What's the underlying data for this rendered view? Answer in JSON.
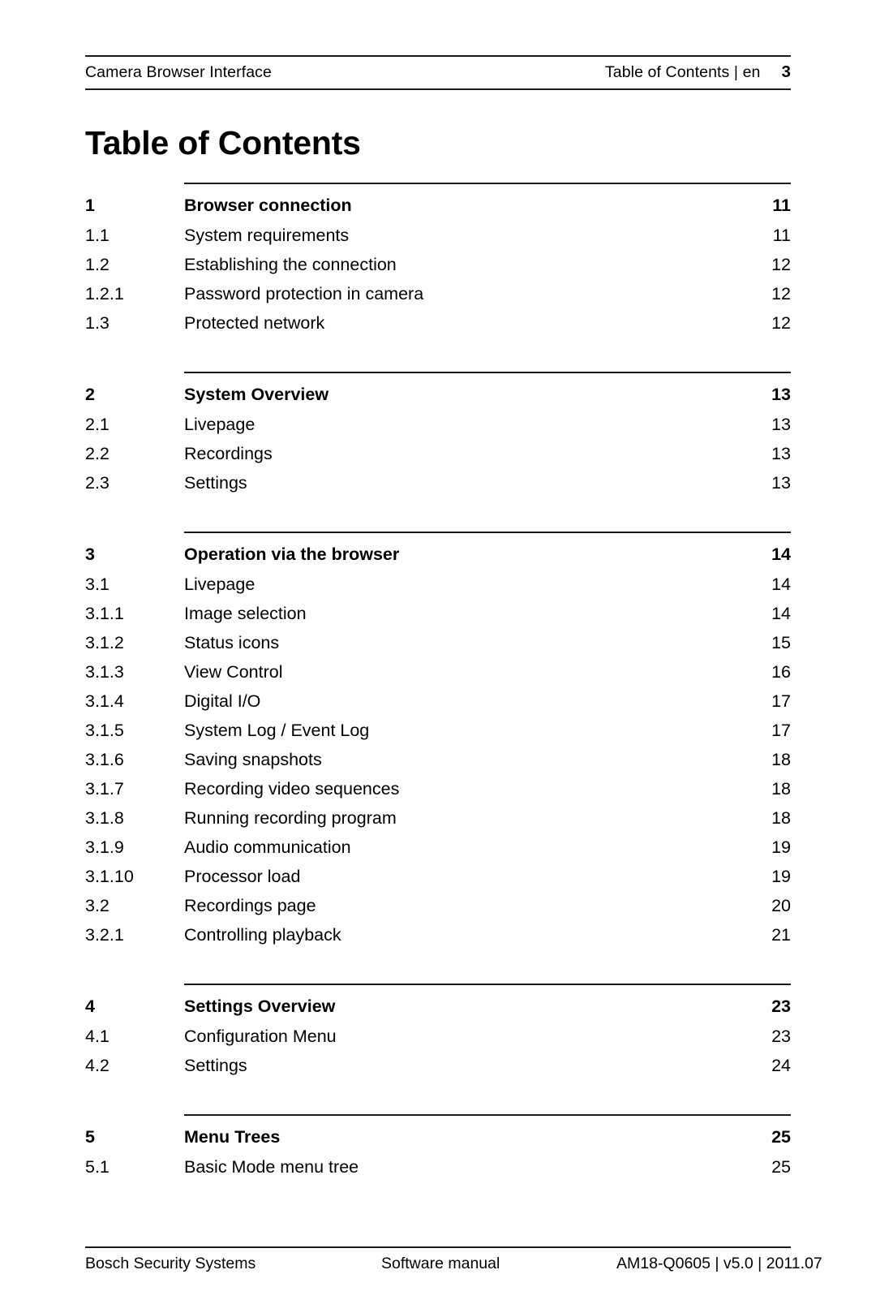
{
  "header": {
    "left_text": "Camera Browser Interface",
    "location": "Table of Contents | en",
    "page_number": "3"
  },
  "title": "Table of Contents",
  "toc": {
    "groups": [
      {
        "entries": [
          {
            "number": "1",
            "title": "Browser connection",
            "page": "11",
            "level": 1
          },
          {
            "number": "1.1",
            "title": "System requirements",
            "page": "11",
            "level": 2
          },
          {
            "number": "1.2",
            "title": "Establishing the connection",
            "page": "12",
            "level": 2
          },
          {
            "number": "1.2.1",
            "title": "Password protection in camera",
            "page": "12",
            "level": 3
          },
          {
            "number": "1.3",
            "title": "Protected network",
            "page": "12",
            "level": 2
          }
        ]
      },
      {
        "entries": [
          {
            "number": "2",
            "title": "System Overview",
            "page": "13",
            "level": 1
          },
          {
            "number": "2.1",
            "title": "Livepage",
            "page": "13",
            "level": 2
          },
          {
            "number": "2.2",
            "title": "Recordings",
            "page": "13",
            "level": 2
          },
          {
            "number": "2.3",
            "title": "Settings",
            "page": "13",
            "level": 2
          }
        ]
      },
      {
        "entries": [
          {
            "number": "3",
            "title": "Operation via the browser",
            "page": "14",
            "level": 1
          },
          {
            "number": "3.1",
            "title": "Livepage",
            "page": "14",
            "level": 2
          },
          {
            "number": "3.1.1",
            "title": "Image selection",
            "page": "14",
            "level": 3
          },
          {
            "number": "3.1.2",
            "title": "Status icons",
            "page": "15",
            "level": 3
          },
          {
            "number": "3.1.3",
            "title": "View Control",
            "page": "16",
            "level": 3
          },
          {
            "number": "3.1.4",
            "title": "Digital I/O",
            "page": "17",
            "level": 3
          },
          {
            "number": "3.1.5",
            "title": "System Log / Event Log",
            "page": "17",
            "level": 3
          },
          {
            "number": "3.1.6",
            "title": "Saving snapshots",
            "page": "18",
            "level": 3
          },
          {
            "number": "3.1.7",
            "title": "Recording video sequences",
            "page": "18",
            "level": 3
          },
          {
            "number": "3.1.8",
            "title": "Running recording program",
            "page": "18",
            "level": 3
          },
          {
            "number": "3.1.9",
            "title": "Audio communication",
            "page": "19",
            "level": 3
          },
          {
            "number": "3.1.10",
            "title": "Processor load",
            "page": "19",
            "level": 3
          },
          {
            "number": "3.2",
            "title": "Recordings page",
            "page": "20",
            "level": 2
          },
          {
            "number": "3.2.1",
            "title": "Controlling playback",
            "page": "21",
            "level": 3
          }
        ]
      },
      {
        "entries": [
          {
            "number": "4",
            "title": "Settings Overview",
            "page": "23",
            "level": 1
          },
          {
            "number": "4.1",
            "title": "Configuration Menu",
            "page": "23",
            "level": 2
          },
          {
            "number": "4.2",
            "title": "Settings",
            "page": "24",
            "level": 2
          }
        ]
      },
      {
        "entries": [
          {
            "number": "5",
            "title": "Menu Trees",
            "page": "25",
            "level": 1
          },
          {
            "number": "5.1",
            "title": "Basic Mode menu tree",
            "page": "25",
            "level": 2
          }
        ]
      }
    ]
  },
  "footer": {
    "left_text": "Bosch Security Systems",
    "center_text": "Software manual",
    "right_text": "AM18-Q0605 | v5.0 | 2011.07"
  }
}
